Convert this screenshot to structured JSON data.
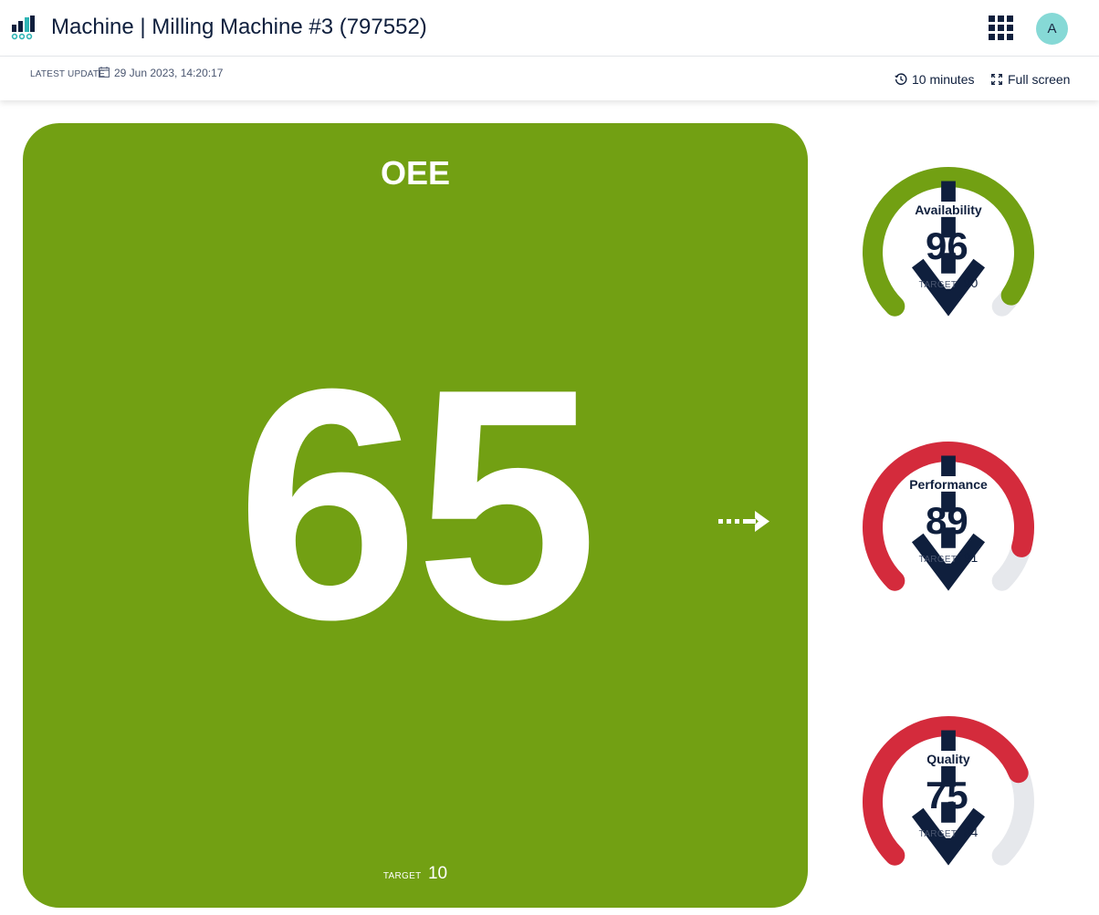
{
  "header": {
    "title": "Machine | Milling Machine #3 (797552)",
    "logo_icon": "bar-chart-logo-icon",
    "apps_icon": "apps-grid-icon",
    "avatar_initial": "A"
  },
  "subheader": {
    "latest_update_label": "LATEST UPDATE",
    "latest_update_value": "29 Jun 2023, 14:20:17",
    "calendar_icon": "calendar-icon",
    "interval_label": "10 minutes",
    "interval_icon": "clock-history-icon",
    "fullscreen_label": "Full screen",
    "fullscreen_icon": "expand-icon"
  },
  "oee": {
    "title": "OEE",
    "value": "65",
    "target_label": "TARGET",
    "target_value": "10",
    "trend_icon": "dotted-arrow-right-icon",
    "color": "#72a013"
  },
  "gauges": [
    {
      "label": "Availability",
      "value": "96",
      "percent": 96,
      "target_label": "TARGET",
      "target_value": "90",
      "trend_icon": "arrow-down-icon",
      "color": "#72a013"
    },
    {
      "label": "Performance",
      "value": "89",
      "percent": 89,
      "target_label": "TARGET",
      "target_value": "91",
      "trend_icon": "arrow-down-icon",
      "color": "#d42b3c"
    },
    {
      "label": "Quality",
      "value": "75",
      "percent": 75,
      "target_label": "TARGET",
      "target_value": "84",
      "trend_icon": "arrow-down-icon",
      "color": "#d42b3c"
    }
  ],
  "colors": {
    "track": "#e6e8ec",
    "text_dark": "#0f1f3d",
    "avatar_bg": "#86d9d6"
  }
}
